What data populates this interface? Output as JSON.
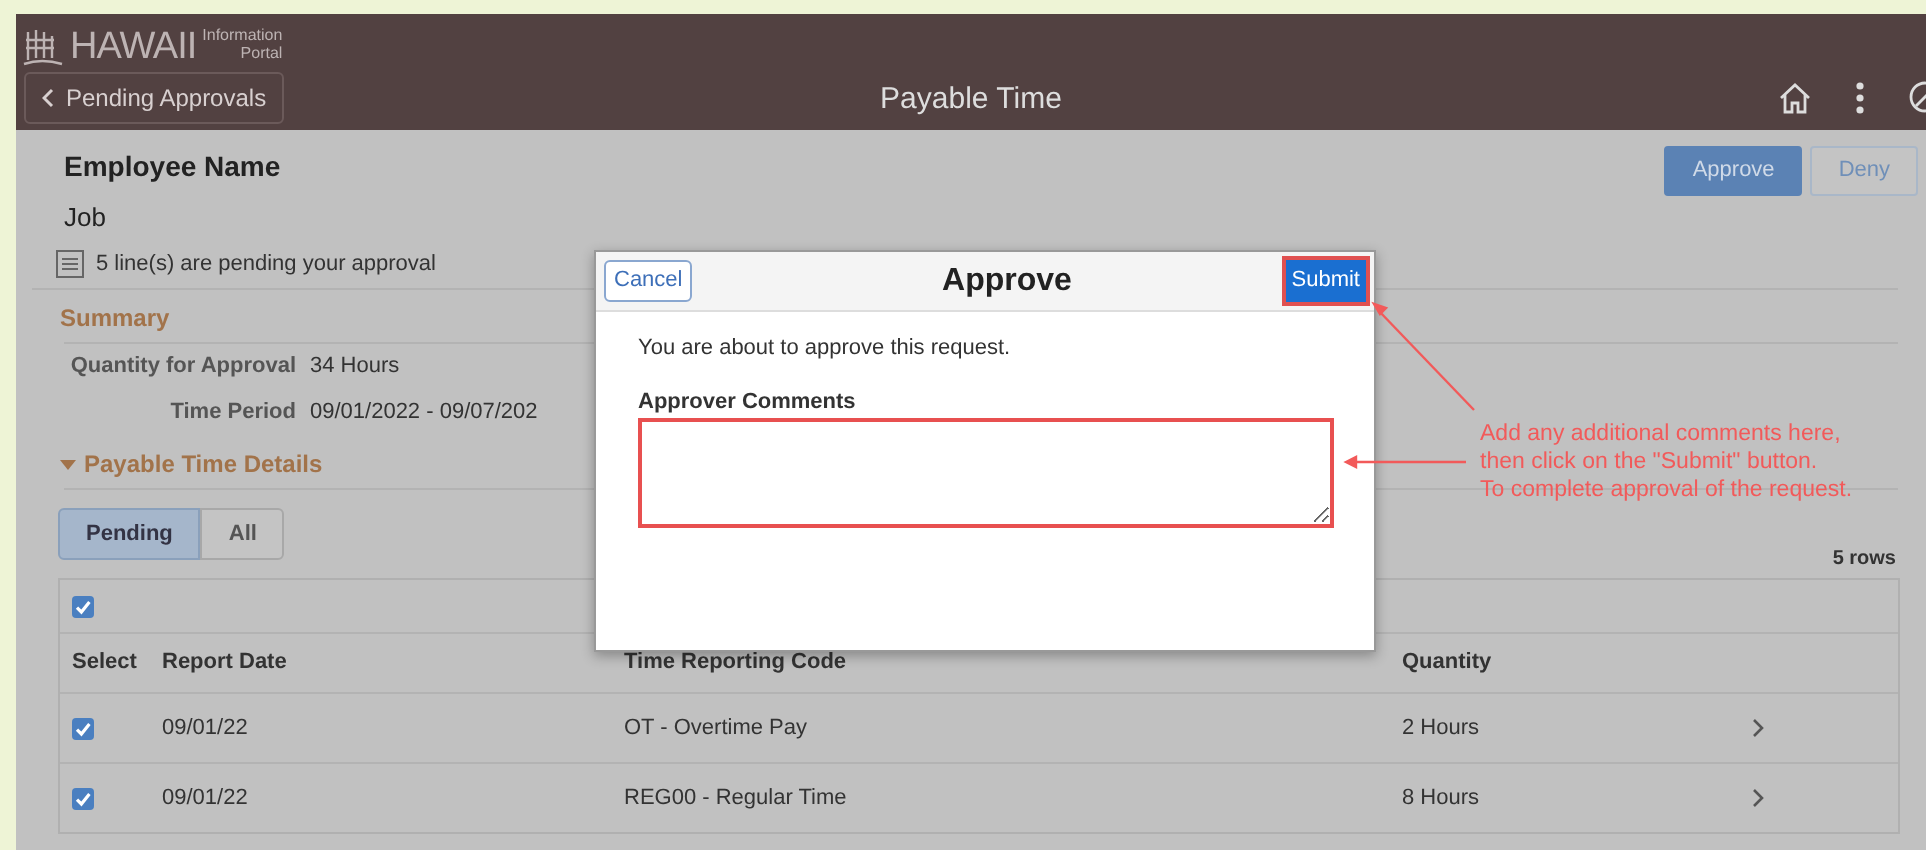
{
  "header": {
    "logo": "HAWAII",
    "logo_sub": [
      "Information",
      "Portal"
    ],
    "back_button": "Pending Approvals",
    "title": "Payable Time"
  },
  "employee": {
    "name": "Employee Name",
    "job": "Job",
    "pending_note": "5 line(s) are pending your approval"
  },
  "actions": [
    {
      "label": "Approve",
      "kind": "primary"
    },
    {
      "label": "Deny",
      "kind": "secondary"
    }
  ],
  "summary": {
    "heading": "Summary",
    "fields": [
      {
        "label": "Quantity for Approval",
        "value": "34 Hours"
      },
      {
        "label": "Time Period",
        "value": "09/01/2022 - 09/07/202"
      }
    ]
  },
  "details": {
    "heading": "Payable Time Details",
    "expanded": true,
    "filters": [
      {
        "label": "Pending",
        "selected": true
      },
      {
        "label": "All",
        "selected": false
      }
    ],
    "row_count": "5 rows",
    "select_all": true,
    "columns": [
      "Select",
      "Report Date",
      "Time Reporting Code",
      "Quantity"
    ],
    "rows": [
      {
        "checked": true,
        "date": "09/01/22",
        "code": "OT - Overtime Pay",
        "quantity": "2 Hours"
      },
      {
        "checked": true,
        "date": "09/01/22",
        "code": "REG00 - Regular Time",
        "quantity": "8 Hours"
      }
    ]
  },
  "dialog": {
    "cancel": "Cancel",
    "title": "Approve",
    "submit": "Submit",
    "message": "You are about to approve this request.",
    "comments_label": "Approver Comments"
  },
  "annotation": {
    "lines": [
      "Add any additional comments here,",
      "then click on the \"Submit\" button.",
      "To complete approval of the request."
    ]
  }
}
